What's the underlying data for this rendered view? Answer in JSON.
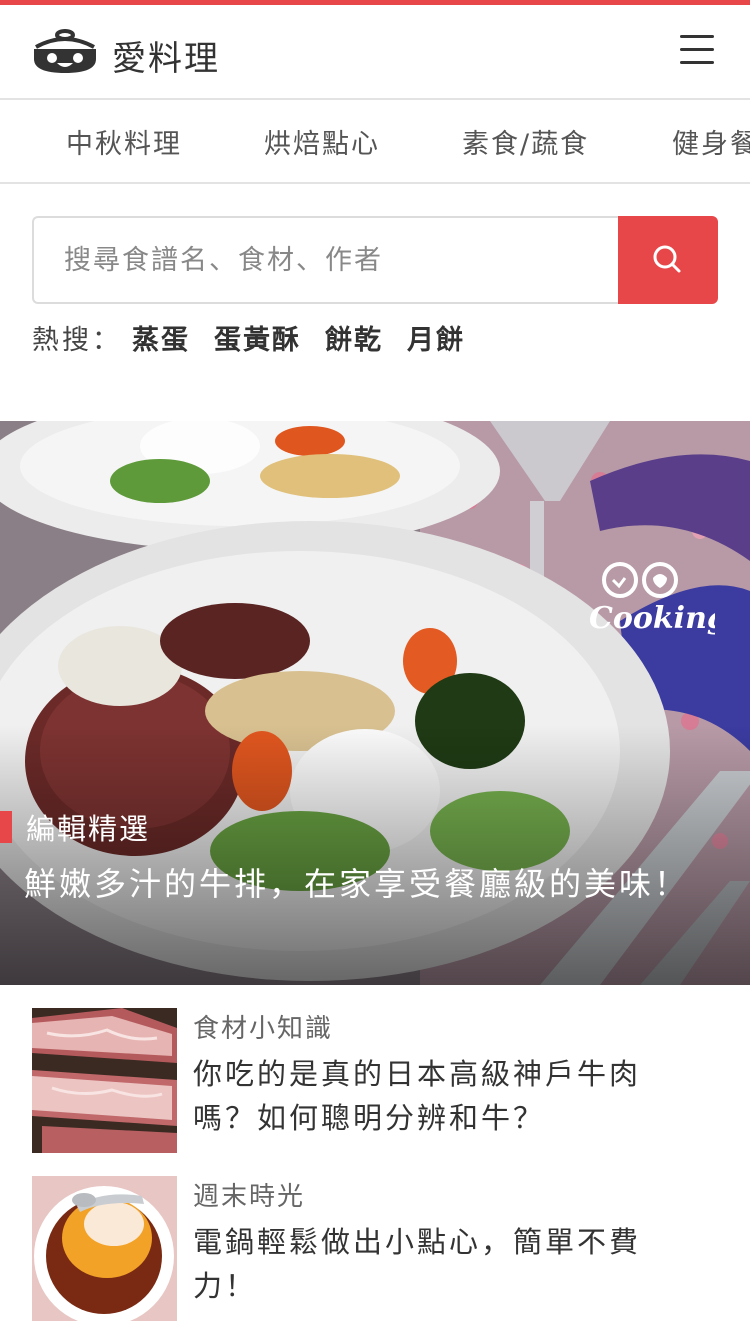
{
  "header": {
    "brand": "愛料理",
    "logo_icon": "pot-logo-icon",
    "menu_icon": "hamburger-menu-icon"
  },
  "categories": [
    "中秋料理",
    "烘焙點心",
    "素食/蔬食",
    "健身餐"
  ],
  "search": {
    "placeholder": "搜尋食譜名、食材、作者",
    "button_icon": "search-icon"
  },
  "hot_search": {
    "label": "熱搜：",
    "keywords": [
      "蒸蛋",
      "蛋黃酥",
      "餅乾",
      "月餅"
    ]
  },
  "featured": {
    "tag": "編輯精選",
    "title": "鮮嫩多汁的牛排，在家享受餐廳級的美味！",
    "watermark": "Cooking"
  },
  "articles": [
    {
      "category": "食材小知識",
      "title": "你吃的是真的日本高級神戶牛肉嗎？如何聰明分辨和牛？"
    },
    {
      "category": "週末時光",
      "title": "電鍋輕鬆做出小點心，簡單不費力！"
    }
  ],
  "colors": {
    "accent": "#e8474a",
    "text": "#333333",
    "divider": "#e3e3e3"
  }
}
